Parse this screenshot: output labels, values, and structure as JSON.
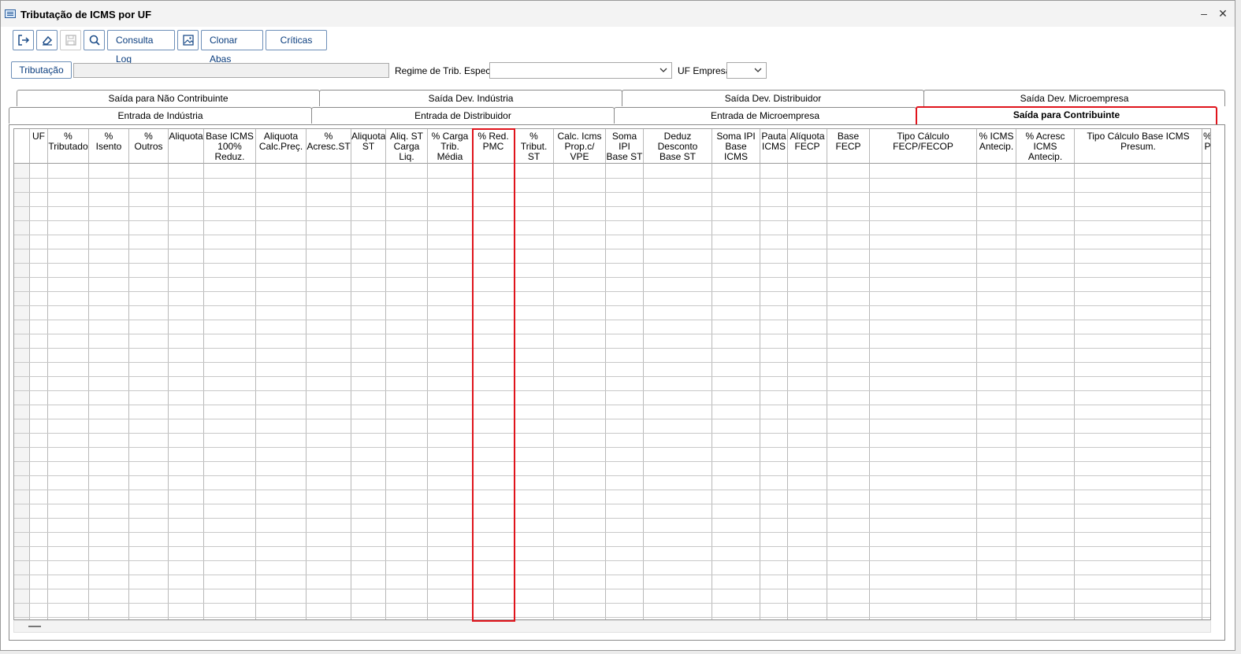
{
  "window": {
    "title": "Tributação de ICMS por UF"
  },
  "toolbar": {
    "consulta_log": "Consulta Log",
    "clonar_abas": "Clonar Abas",
    "criticas": "Críticas"
  },
  "filters": {
    "tributacao_button": "Tributação",
    "tributacao_value": "",
    "regime_label": "Regime de Trib. Especial",
    "regime_value": "",
    "uf_label": "UF Empresa",
    "uf_value": ""
  },
  "tabs_row1": [
    "Saída para Não Contribuinte",
    "Saída Dev. Indústria",
    "Saída Dev. Distribuidor",
    "Saída Dev. Microempresa"
  ],
  "tabs_row2": [
    "Entrada de Indústria",
    "Entrada de Distribuidor",
    "Entrada de Microempresa",
    "Saída para Contribuinte"
  ],
  "active_tab": "Saída para Contribuinte",
  "grid": {
    "columns": [
      "UF",
      "%\nTributado",
      "%\nIsento",
      "%\nOutros",
      "Aliquota",
      "Base ICMS\n100% Reduz.",
      "Aliquota\nCalc.Preç.",
      "%\nAcresc.ST",
      "Aliquota\nST",
      "Aliq. ST\nCarga Liq.",
      "% Carga\nTrib. Média",
      "% Red.\nPMC",
      "%\nTribut. ST",
      "Calc. Icms\nProp.c/ VPE",
      "Soma IPI\nBase ST",
      "Deduz Desconto\nBase ST",
      "Soma IPI\nBase ICMS",
      "Pauta\nICMS",
      "Alíquota\nFECP",
      "Base\nFECP",
      "Tipo Cálculo FECP/FECOP",
      "% ICMS\nAntecip.",
      "% Acresc\nICMS Antecip.",
      "Tipo Cálculo Base ICMS Presum.",
      "%\nP"
    ],
    "highlighted_column": "% Red.\nPMC"
  }
}
